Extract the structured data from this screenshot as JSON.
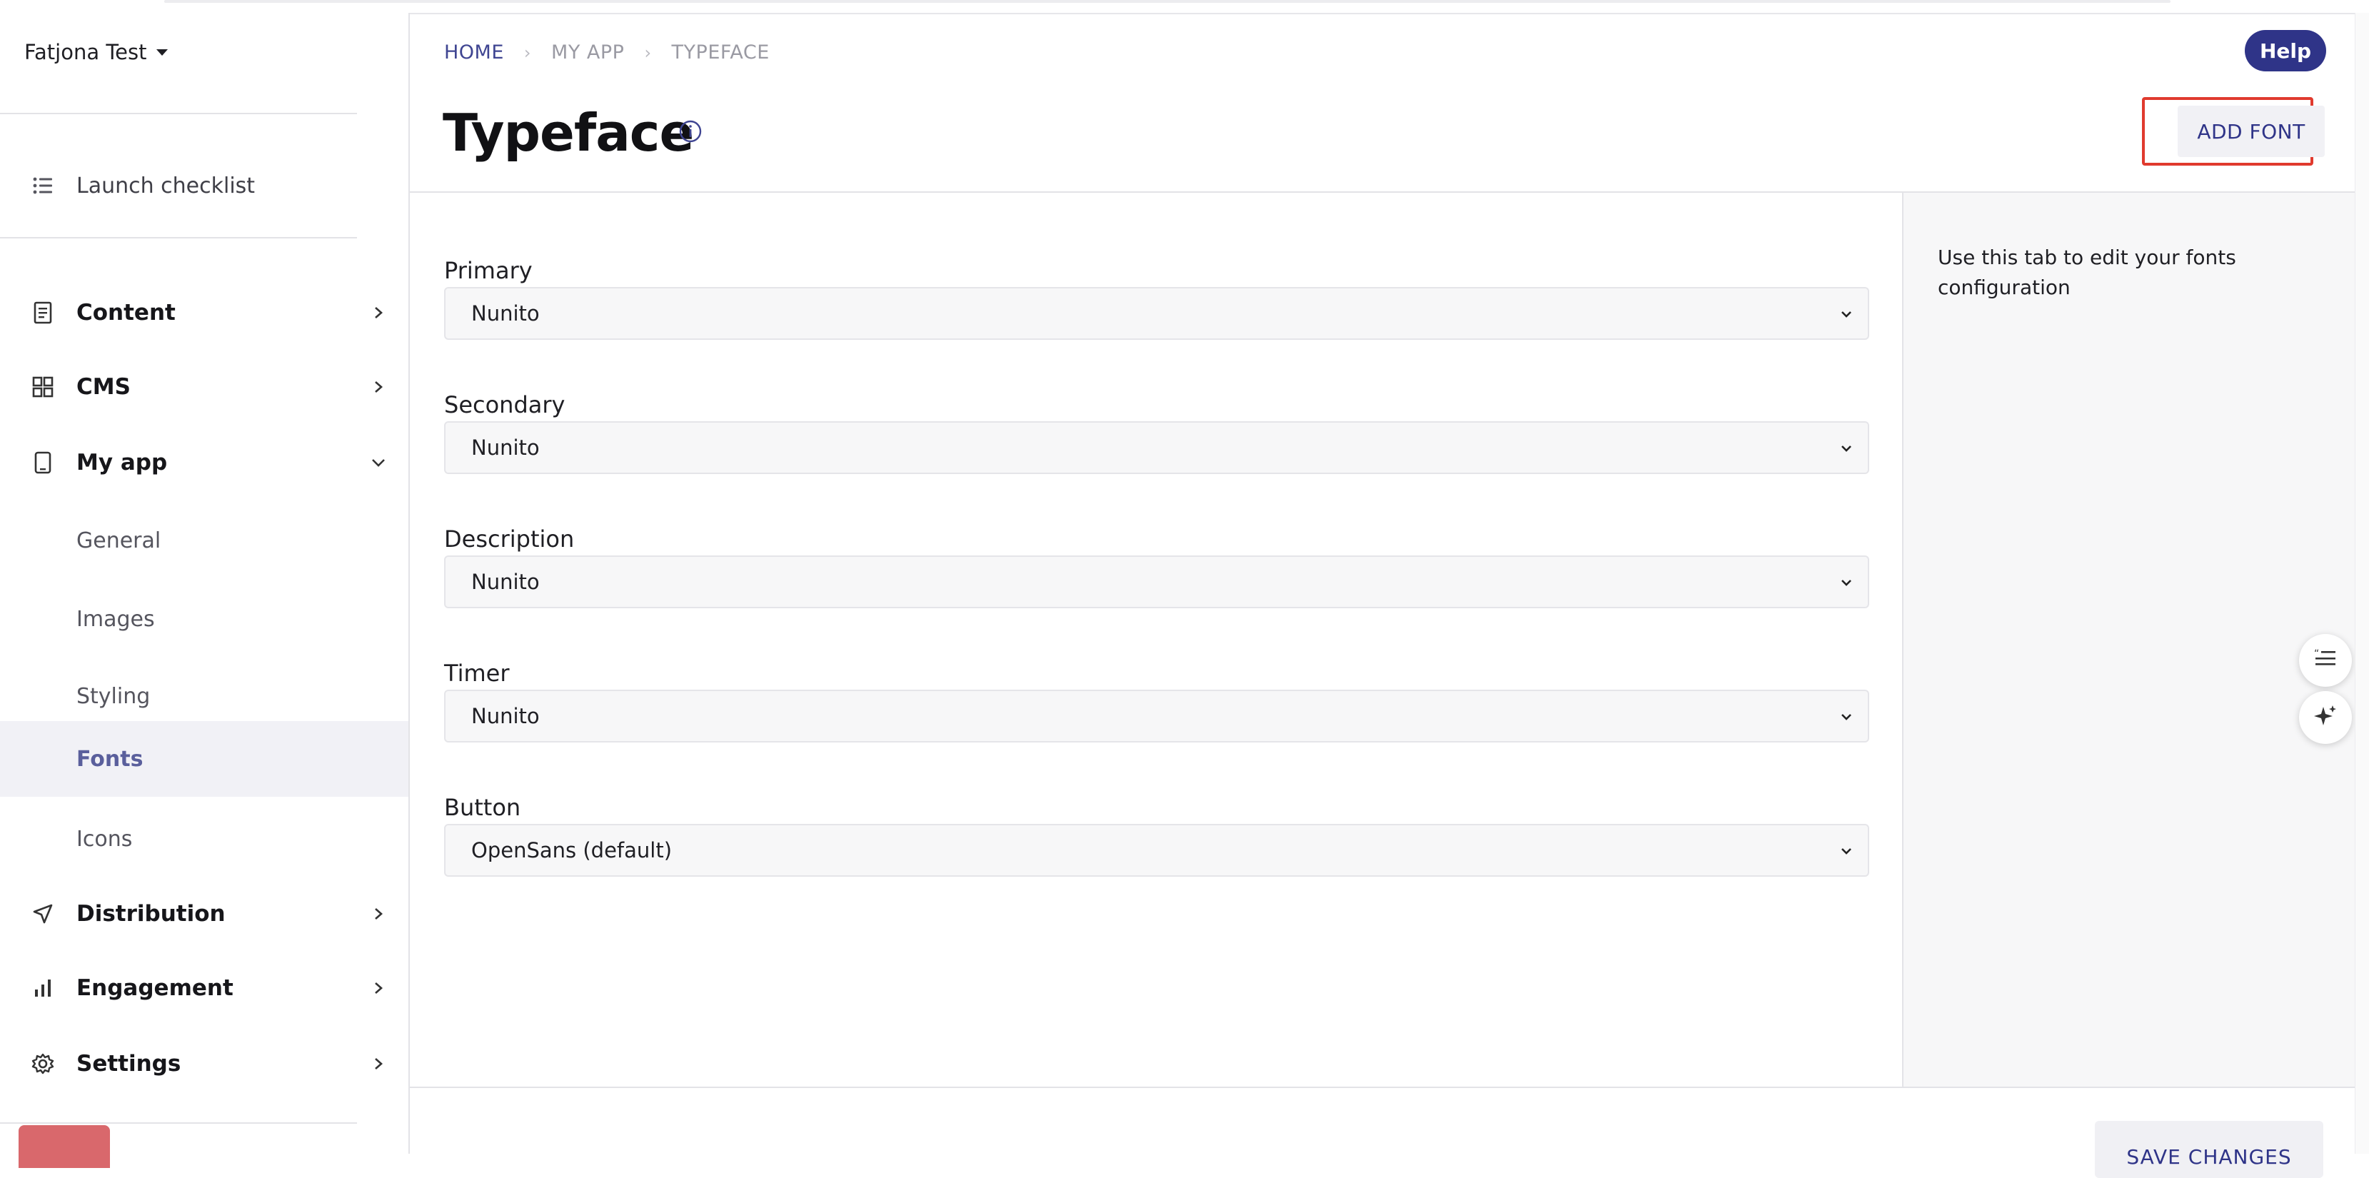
{
  "account": {
    "name": "Fatjona Test"
  },
  "sidebar": {
    "launch_checklist": "Launch checklist",
    "items": [
      {
        "label": "Content",
        "icon": "document-icon"
      },
      {
        "label": "CMS",
        "icon": "grid-icon"
      },
      {
        "label": "My app",
        "icon": "phone-icon"
      },
      {
        "label": "General"
      },
      {
        "label": "Images"
      },
      {
        "label": "Styling"
      },
      {
        "label": "Fonts",
        "active": true
      },
      {
        "label": "Icons"
      },
      {
        "label": "Distribution",
        "icon": "send-icon"
      },
      {
        "label": "Engagement",
        "icon": "bar-chart-icon"
      },
      {
        "label": "Settings",
        "icon": "gear-icon"
      }
    ]
  },
  "breadcrumb": [
    "HOME",
    "MY APP",
    "TYPEFACE"
  ],
  "header": {
    "help": "Help",
    "title": "Typeface",
    "add_font": "ADD FONT"
  },
  "fields": [
    {
      "label": "Primary",
      "value": "Nunito"
    },
    {
      "label": "Secondary",
      "value": "Nunito"
    },
    {
      "label": "Description",
      "value": "Nunito"
    },
    {
      "label": "Timer",
      "value": "Nunito"
    },
    {
      "label": "Button",
      "value": "OpenSans (default)"
    }
  ],
  "help_panel": {
    "text": "Use this tab to edit your fonts configuration"
  },
  "footer": {
    "save": "SAVE CHANGES"
  },
  "colors": {
    "accent": "#2f3488",
    "highlight": "#e03a2e",
    "active_bg": "#f1f1f6"
  }
}
